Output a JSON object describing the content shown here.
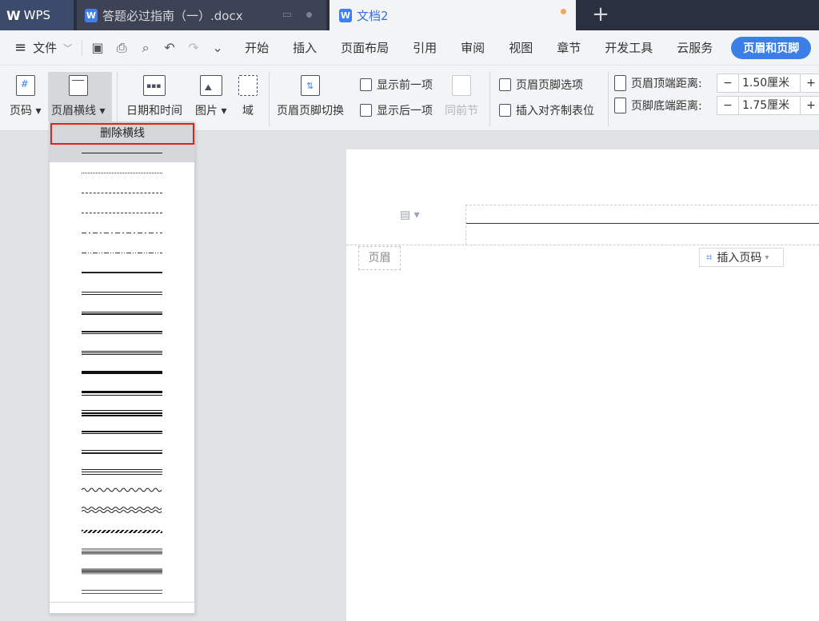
{
  "titlebar": {
    "app_tab": "WPS",
    "doc1_tab": "答题必过指南（一）.docx",
    "doc2_tab": "文档2",
    "new_tab": "+"
  },
  "menubar": {
    "file": "文件",
    "items": [
      "开始",
      "插入",
      "页面布局",
      "引用",
      "审阅",
      "视图",
      "章节",
      "开发工具",
      "云服务"
    ],
    "active": "页眉和页脚"
  },
  "ribbon": {
    "page_number": "页码",
    "header_line": "页眉横线",
    "date_time": "日期和时间",
    "picture": "图片",
    "field": "域",
    "header_footer_switch": "页眉页脚切换",
    "show_prev": "显示前一项",
    "show_next": "显示后一项",
    "same_as_prev": "同前节",
    "hf_options": "页眉页脚选项",
    "insert_align_tab": "插入对齐制表位",
    "header_top_distance_label": "页眉顶端距离:",
    "header_top_distance_value": "1.50厘米",
    "footer_bottom_distance_label": "页脚底端距离:",
    "footer_bottom_distance_value": "1.75厘米",
    "minus": "−",
    "plus": "+"
  },
  "dropdown": {
    "delete_line": "删除横线"
  },
  "document": {
    "header_label": "页眉",
    "insert_page_number": "插入页码"
  },
  "colors": {
    "accent": "#3b7fe6",
    "highlight_border": "#e0211e",
    "titlebar_bg": "#2b3040"
  }
}
